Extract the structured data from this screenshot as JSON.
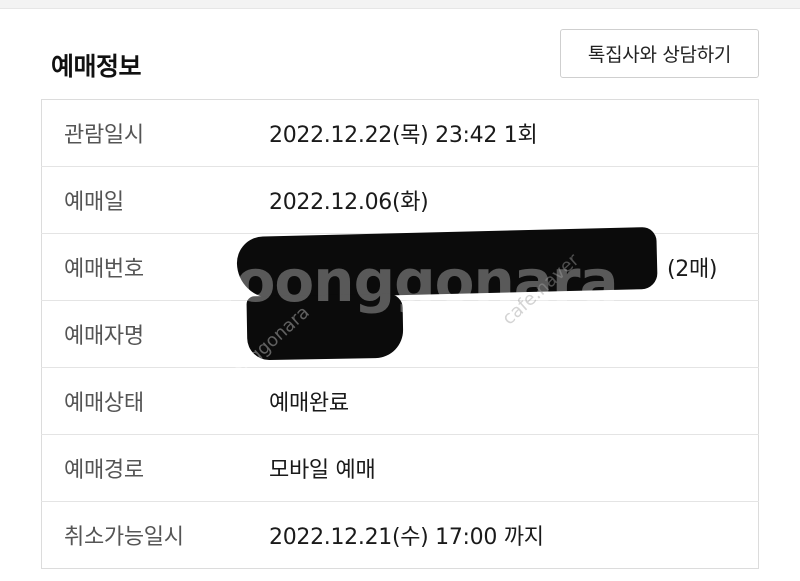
{
  "section": {
    "title": "예매정보",
    "consult_button_label": "톡집사와 상담하기"
  },
  "rows": [
    {
      "label": "관람일시",
      "value": "2022.12.22(목) 23:42 1회"
    },
    {
      "label": "예매일",
      "value": "2022.12.06(화)"
    },
    {
      "label": "예매번호",
      "value": "",
      "suffix": "(2매)"
    },
    {
      "label": "예매자명",
      "value": ""
    },
    {
      "label": "예매상태",
      "value": "예매완료"
    },
    {
      "label": "예매경로",
      "value": "모바일 예매"
    },
    {
      "label": "취소가능일시",
      "value": "2022.12.21(수) 17:00 까지"
    }
  ],
  "watermark": {
    "main": "Joonggonara",
    "small": "cafe.naver",
    "small_2": "joonggonara"
  },
  "colors": {
    "redaction": "#0b0b0b",
    "border": "#dcdcdc",
    "label_text": "#555555",
    "value_text": "#1a1a1a"
  }
}
